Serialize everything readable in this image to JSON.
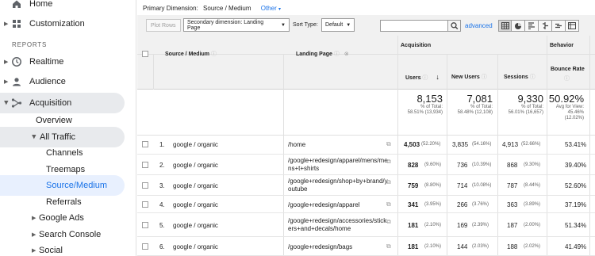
{
  "sidebar": {
    "items_top": [
      {
        "label": "Home",
        "icon": "home-icon"
      },
      {
        "label": "Customization",
        "icon": "customization-icon"
      }
    ],
    "section_label": "REPORTS",
    "reports": [
      {
        "label": "Realtime",
        "icon": "clock-icon"
      },
      {
        "label": "Audience",
        "icon": "person-icon"
      },
      {
        "label": "Acquisition",
        "icon": "acquisition-icon"
      }
    ],
    "acquisition_children": {
      "overview": "Overview",
      "all_traffic": "All Traffic",
      "all_traffic_children": [
        "Channels",
        "Treemaps",
        "Source/Medium",
        "Referrals"
      ],
      "more": [
        "Google Ads",
        "Search Console",
        "Social"
      ]
    }
  },
  "dimension_bar": {
    "label": "Primary Dimension:",
    "value": "Source / Medium",
    "other": "Other"
  },
  "toolbar": {
    "plot_rows": "Plot Rows",
    "secondary_dimension": "Secondary dimension: Landing Page",
    "sort_type_label": "Sort Type:",
    "sort_type_value": "Default",
    "search_value": "",
    "advanced": "advanced"
  },
  "table": {
    "group_acquisition": "Acquisition",
    "group_behavior": "Behavior",
    "col_source": "Source / Medium",
    "col_landing": "Landing Page",
    "col_users": "Users",
    "col_new_users": "New Users",
    "col_sessions": "Sessions",
    "col_bounce": "Bounce Rate",
    "totals": {
      "users": "8,153",
      "users_pct": "% of Total:",
      "users_of": "58.51% (13,934)",
      "new_users": "7,081",
      "new_users_pct": "% of Total:",
      "new_users_of": "58.48% (12,108)",
      "sessions": "9,330",
      "sessions_pct": "% of Total:",
      "sessions_of": "56.01% (16,657)",
      "bounce": "50.92%",
      "bounce_sub": "Avg for View:",
      "bounce_of": "45.46%",
      "bounce_diff": "(12.02%)"
    },
    "rows": [
      {
        "n": "1.",
        "source": "google / organic",
        "landing": "/home",
        "users": "4,503",
        "users_pct": "(52.20%)",
        "new_users": "3,835",
        "new_users_pct": "(54.16%)",
        "sessions": "4,913",
        "sessions_pct": "(52.66%)",
        "bounce": "53.41%"
      },
      {
        "n": "2.",
        "source": "google / organic",
        "landing": "/google+redesign/apparel/mens/mens+t+shirts",
        "users": "828",
        "users_pct": "(9.60%)",
        "new_users": "736",
        "new_users_pct": "(10.39%)",
        "sessions": "868",
        "sessions_pct": "(9.30%)",
        "bounce": "39.40%"
      },
      {
        "n": "3.",
        "source": "google / organic",
        "landing": "/google+redesign/shop+by+brand/youtube",
        "users": "759",
        "users_pct": "(8.80%)",
        "new_users": "714",
        "new_users_pct": "(10.08%)",
        "sessions": "787",
        "sessions_pct": "(8.44%)",
        "bounce": "52.60%"
      },
      {
        "n": "4.",
        "source": "google / organic",
        "landing": "/google+redesign/apparel",
        "users": "341",
        "users_pct": "(3.95%)",
        "new_users": "266",
        "new_users_pct": "(3.76%)",
        "sessions": "363",
        "sessions_pct": "(3.89%)",
        "bounce": "37.19%"
      },
      {
        "n": "5.",
        "source": "google / organic",
        "landing": "/google+redesign/accessories/stickers+and+decals/home",
        "users": "181",
        "users_pct": "(2.10%)",
        "new_users": "169",
        "new_users_pct": "(2.39%)",
        "sessions": "187",
        "sessions_pct": "(2.00%)",
        "bounce": "51.34%"
      },
      {
        "n": "6.",
        "source": "google / organic",
        "landing": "/google+redesign/bags",
        "users": "181",
        "users_pct": "(2.10%)",
        "new_users": "144",
        "new_users_pct": "(2.03%)",
        "sessions": "188",
        "sessions_pct": "(2.02%)",
        "bounce": "41.49%"
      }
    ]
  }
}
